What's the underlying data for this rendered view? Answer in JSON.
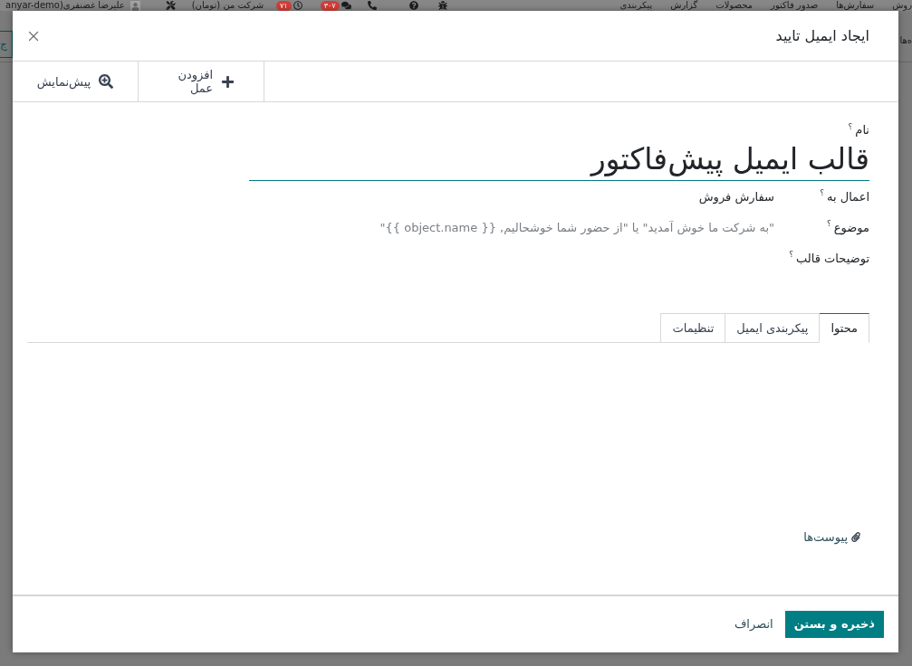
{
  "background": {
    "navbar": {
      "menu": [
        {
          "label": "روش"
        },
        {
          "label": "سفارش‌ها"
        },
        {
          "label": "صدور فاکتور"
        },
        {
          "label": "محصولات"
        },
        {
          "label": "گزارش"
        },
        {
          "label": "پیکربندی"
        }
      ],
      "message_count": "۳۰۷",
      "activity_count": "۷۱",
      "company": "شرکت من (تومان)",
      "user": "علیرضا غضنفری",
      "database": "anyar-demo)"
    },
    "breadcrumb": "ه‌ها",
    "new_button": "ج"
  },
  "dialog": {
    "title": "ایجاد ایمیل تایید",
    "toolbar": [
      {
        "kind": "add",
        "label": "افزودن عمل"
      },
      {
        "kind": "preview",
        "label": "پیش‌نمایش"
      }
    ],
    "form": {
      "name": {
        "label": "نام",
        "hint": "؟",
        "value": "قالب ایمیل پیش‌فاکتور"
      },
      "fields": [
        {
          "kind": "value",
          "label": "اعمال به",
          "hint": "؟",
          "value": "سفارش فروش"
        },
        {
          "kind": "input",
          "label": "موضوع",
          "hint": "؟",
          "placeholder": "\"به شرکت ما خوش آمدید\" یا \"از حضور شما خوشحالیم, {{ object.name }}\""
        },
        {
          "kind": "empty",
          "label": "توضیحات قالب",
          "hint": "؟"
        }
      ]
    },
    "tabs": [
      {
        "label": "محتوا",
        "selected": true
      },
      {
        "label": "پیکربندی ایمیل",
        "selected": false
      },
      {
        "label": "تنظیمات",
        "selected": false
      }
    ],
    "attachments": "پیوست‌ها",
    "footer": {
      "save": "ذخیره و بستن",
      "cancel": "انصراف"
    }
  }
}
